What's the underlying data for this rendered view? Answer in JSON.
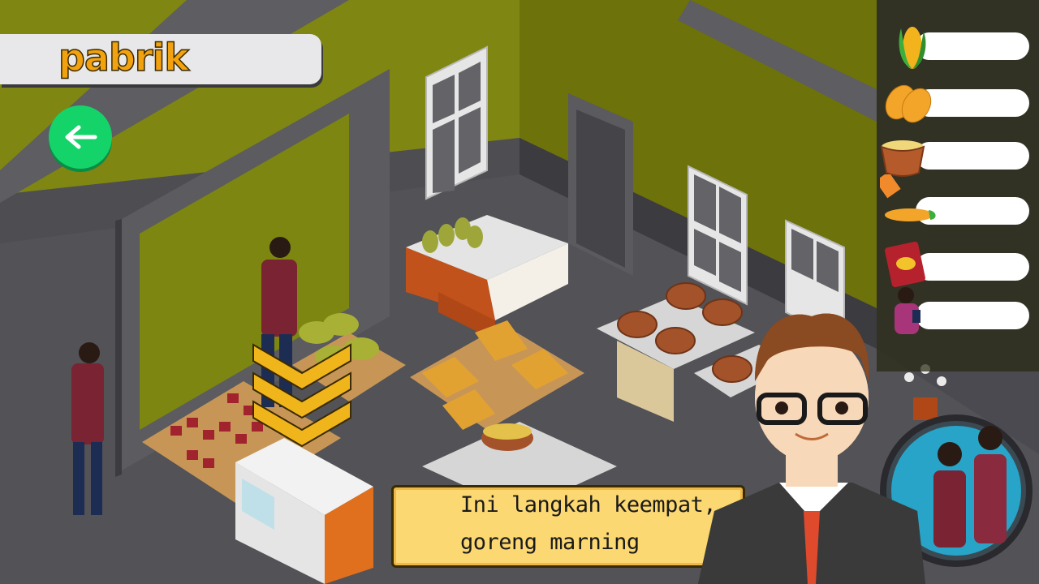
{
  "header": {
    "title": "pabrik"
  },
  "dialog": {
    "line1": "Ini langkah keempat,",
    "line2": "goreng marning"
  },
  "inventory": {
    "items": [
      {
        "icon": "corn-cob-icon"
      },
      {
        "icon": "dried-corn-kernels-icon"
      },
      {
        "icon": "basket-soaking-icon"
      },
      {
        "icon": "corn-knife-icon"
      },
      {
        "icon": "marning-package-icon"
      },
      {
        "icon": "worker-icon"
      }
    ]
  },
  "colors": {
    "accent": "#f3a20f",
    "back_button": "#14d368",
    "dialog_bg": "#fcd872",
    "wall": "#8a8a1a"
  }
}
